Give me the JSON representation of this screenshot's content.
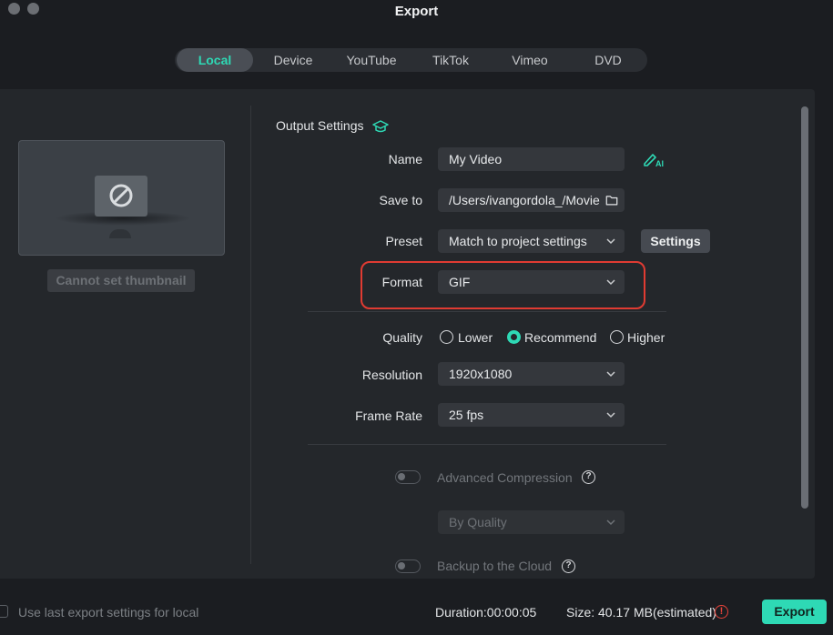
{
  "window": {
    "title": "Export"
  },
  "tabs": [
    "Local",
    "Device",
    "YouTube",
    "TikTok",
    "Vimeo",
    "DVD"
  ],
  "active_tab": "Local",
  "thumbnail": {
    "button_label": "Cannot set thumbnail",
    "icon": "no-entry-icon"
  },
  "output": {
    "section_title": "Output Settings",
    "section_icon": "graduation-cap-icon",
    "name_label": "Name",
    "name_value": "My Video",
    "name_ai_icon": "ai-edit-icon",
    "save_label": "Save to",
    "save_value": "/Users/ivangordola_/Movies",
    "preset_label": "Preset",
    "preset_value": "Match to project settings",
    "settings_button": "Settings",
    "format_label": "Format",
    "format_value": "GIF",
    "quality_label": "Quality",
    "quality_options": [
      "Lower",
      "Recommend",
      "Higher"
    ],
    "quality_selected": "Recommend",
    "resolution_label": "Resolution",
    "resolution_value": "1920x1080",
    "framerate_label": "Frame Rate",
    "framerate_value": "25 fps",
    "advanced_label": "Advanced Compression",
    "advanced_mode": "By Quality",
    "backup_label": "Backup to the Cloud"
  },
  "footer": {
    "use_last_label": "Use last export settings for local",
    "duration": "Duration:00:00:05",
    "size": "Size: 40.17 MB(estimated)",
    "export_button": "Export"
  },
  "colors": {
    "accent": "#2ed9b5",
    "highlight": "#e03b32",
    "warning": "#e8433a"
  }
}
